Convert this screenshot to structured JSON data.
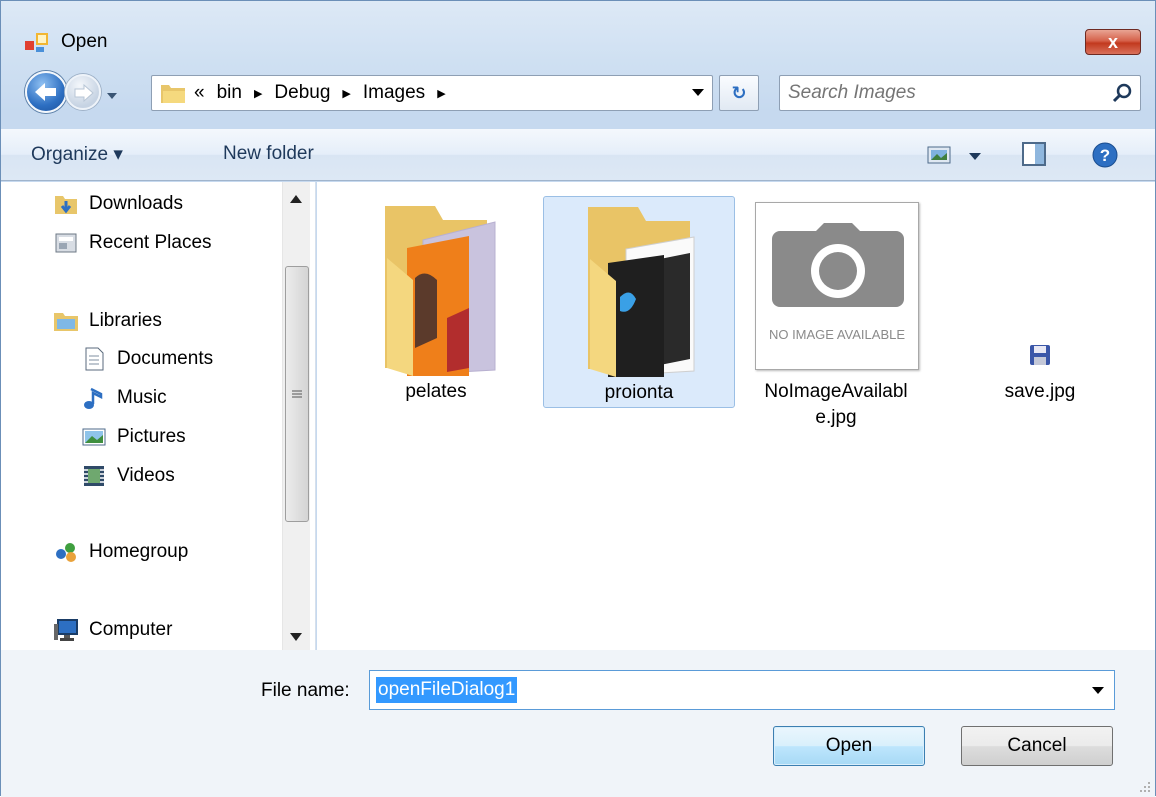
{
  "window": {
    "title": "Open",
    "close_label": "x"
  },
  "address": {
    "crumbs": [
      "«",
      "bin",
      "Debug",
      "Images"
    ]
  },
  "search": {
    "placeholder": "Search Images"
  },
  "toolbar": {
    "organize": "Organize ▾",
    "new_folder": "New folder"
  },
  "nav": {
    "items": [
      {
        "label": "Downloads",
        "icon": "downloads-icon"
      },
      {
        "label": "Recent Places",
        "icon": "recent-places-icon"
      },
      {
        "label": "Libraries",
        "icon": "libraries-icon"
      },
      {
        "label": "Documents",
        "icon": "documents-icon"
      },
      {
        "label": "Music",
        "icon": "music-icon"
      },
      {
        "label": "Pictures",
        "icon": "pictures-icon"
      },
      {
        "label": "Videos",
        "icon": "videos-icon"
      },
      {
        "label": "Homegroup",
        "icon": "homegroup-icon"
      },
      {
        "label": "Computer",
        "icon": "computer-icon"
      }
    ]
  },
  "files": [
    {
      "name": "pelates",
      "type": "folder"
    },
    {
      "name": "proionta",
      "type": "folder",
      "selected": true
    },
    {
      "name_line1": "NoImageAvailabl",
      "name_line2": "e.jpg",
      "type": "image",
      "thumbnail_text": "NO IMAGE AVAILABLE"
    },
    {
      "name": "save.jpg",
      "type": "image"
    }
  ],
  "filename": {
    "label": "File name:",
    "value": "openFileDialog1"
  },
  "buttons": {
    "open": "Open",
    "cancel": "Cancel"
  },
  "colors": {
    "accent": "#3399ff",
    "selection_bg": "#dbeafb",
    "selection_border": "#9bbfe5"
  }
}
